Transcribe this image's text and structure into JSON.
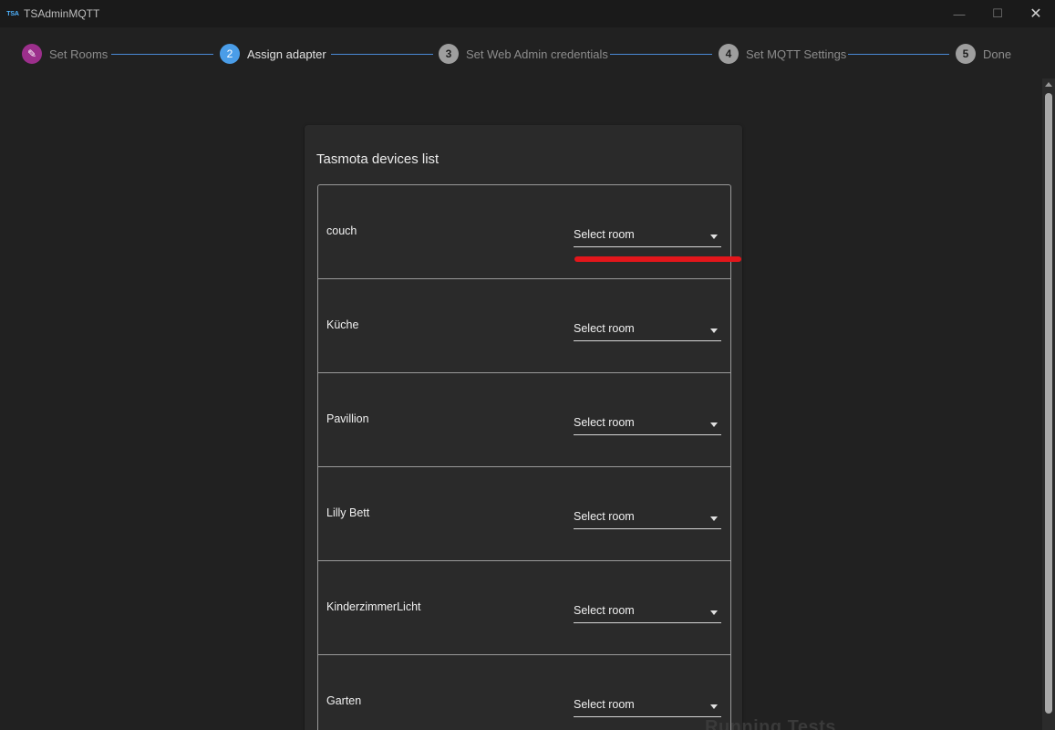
{
  "app": {
    "icon_text": "TSA",
    "title": "TSAdminMQTT",
    "controls": {
      "minimize": "—",
      "maximize": "☐",
      "close": "✕"
    }
  },
  "stepper": {
    "steps": [
      {
        "number": "✎",
        "label": "Set Rooms",
        "state": "completed"
      },
      {
        "number": "2",
        "label": "Assign adapter",
        "state": "active"
      },
      {
        "number": "3",
        "label": "Set Web Admin credentials",
        "state": "pending"
      },
      {
        "number": "4",
        "label": "Set MQTT Settings",
        "state": "pending"
      },
      {
        "number": "5",
        "label": "Done",
        "state": "pending"
      }
    ],
    "colors": {
      "completed": "#9c2f8c",
      "active": "#4a9de8",
      "pending": "#9e9e9e",
      "connector": "#4a8ad6"
    }
  },
  "card": {
    "title": "Tasmota devices list",
    "devices": [
      {
        "name": "couch",
        "select": "Select room"
      },
      {
        "name": "Küche",
        "select": "Select room"
      },
      {
        "name": "Pavillion",
        "select": "Select room"
      },
      {
        "name": "Lilly Bett",
        "select": "Select room"
      },
      {
        "name": "KinderzimmerLicht",
        "select": "Select room"
      },
      {
        "name": "Garten",
        "select": "Select room"
      }
    ]
  },
  "background": {
    "partial_text": "Running Tests"
  }
}
